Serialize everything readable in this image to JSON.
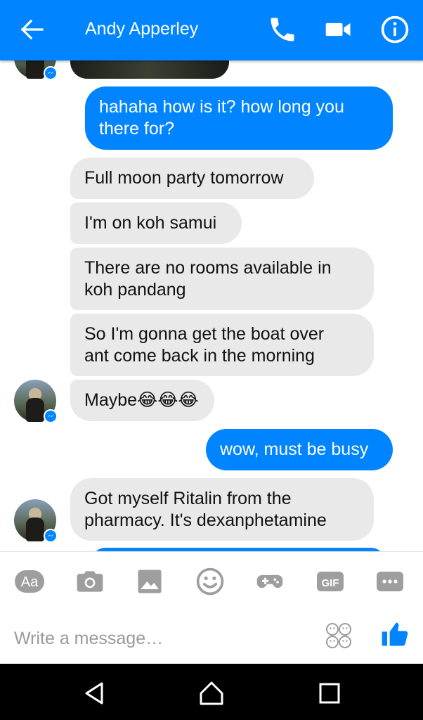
{
  "header": {
    "contact_name": "Andy Apperley",
    "icons": [
      "back-arrow-icon",
      "phone-icon",
      "video-camera-icon",
      "info-icon"
    ],
    "color": "#0084ff"
  },
  "messages": [
    {
      "side": "out",
      "lines": [
        "hahaha how is it? how long you",
        "there for?"
      ]
    },
    {
      "side": "in",
      "lines": [
        "Full moon party tomorrow"
      ]
    },
    {
      "side": "in",
      "lines": [
        "I'm on koh samui"
      ]
    },
    {
      "side": "in",
      "lines": [
        "There are no rooms available in",
        "koh pandang"
      ]
    },
    {
      "side": "in",
      "lines": [
        "So I'm gonna get the boat over",
        "ant come back in the morning"
      ]
    },
    {
      "side": "in",
      "lines": [
        "Maybe😂😂😂"
      ]
    },
    {
      "side": "out",
      "lines": [
        "wow, must be busy"
      ]
    },
    {
      "side": "in",
      "lines": [
        "Got myself Ritalin from the",
        "pharmacy. It's dexanphetamine"
      ]
    }
  ],
  "composer": {
    "placeholder": "Write a message…",
    "tools": [
      "text-format-icon",
      "camera-icon",
      "gallery-icon",
      "emoji-icon",
      "game-icon",
      "gif-icon",
      "more-icon"
    ],
    "gif_label": "GIF",
    "aa_label": "Aa"
  },
  "colors": {
    "outgoing_bubble": "#0084ff",
    "incoming_bubble": "#e9e9e9",
    "tool_gray": "#9e9e9e"
  }
}
